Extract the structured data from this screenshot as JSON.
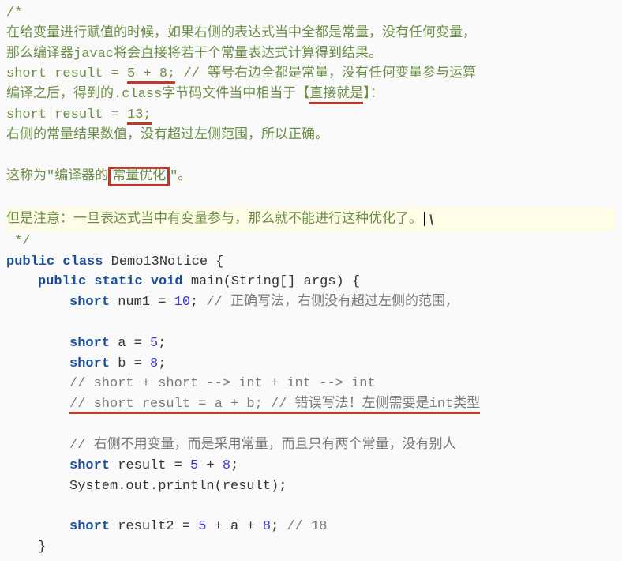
{
  "comment_block": {
    "l1": "/*",
    "l2": "在给变量进行赋值的时候，如果右侧的表达式当中全都是常量，没有任何变量，",
    "l3": "那么编译器javac将会直接将若干个常量表达式计算得到结果。",
    "l4a": "short result = ",
    "l4_expr": "5 + 8;",
    "l4b": " // 等号右边全都是常量，没有任何变量参与运算",
    "l5a": "编译之后，得到的.class字节码文件当中相当于【",
    "l5_under": "直接就是",
    "l5b": "】：",
    "l6a": "short result = ",
    "l6_expr": "13;",
    "l7": "右侧的常量结果数值，没有超过左侧范围，所以正确。",
    "l8a": "这称为\"编译器的",
    "l8_box": "常量优化",
    "l8b": "\"。",
    "l9": "但是注意：一旦表达式当中有变量参与，那么就不能进行这种优化了。",
    "l10": " */"
  },
  "code": {
    "class_decl_pre": "public class ",
    "class_name": "Demo13Notice {",
    "main_pre": "public static void ",
    "main_sig": "main(String[] args) {",
    "num1_a": "short ",
    "num1_b": "num1 = ",
    "num1_val": "10",
    "num1_c": "; ",
    "num1_comment": "// 正确写法，右侧没有超过左侧的范围,",
    "a_decl_a": "short ",
    "a_decl_b": "a = ",
    "a_val": "5",
    "a_decl_c": ";",
    "b_decl_a": "short ",
    "b_decl_b": "b = ",
    "b_val": "8",
    "b_decl_c": ";",
    "c1": "// short + short --> int + int --> int",
    "c2": "// short result = a + b; // 错误写法！左侧需要是int类型",
    "c3": "// 右侧不用变量，而是采用常量，而且只有两个常量，没有别人",
    "res_a": "short ",
    "res_b": "result = ",
    "res_v1": "5",
    "res_plus": " + ",
    "res_v2": "8",
    "res_c": ";",
    "println": "System.out.println(result);",
    "res2_a": "short ",
    "res2_b": "result2 = ",
    "res2_v1": "5",
    "res2_p1": " + a + ",
    "res2_v2": "8",
    "res2_c": "; ",
    "res2_comment": "// 18",
    "close": "}"
  }
}
